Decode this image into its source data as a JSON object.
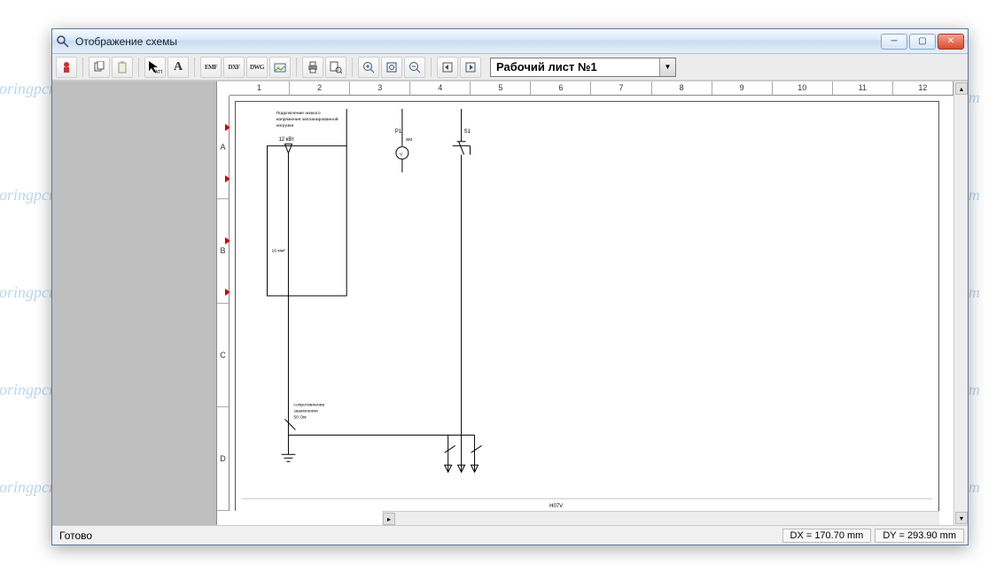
{
  "window": {
    "title": "Отображение схемы"
  },
  "toolbar": {
    "export_emf": "EMF",
    "export_dxf": "DXF",
    "export_dwg": "DWG",
    "att": "ATT",
    "sheet_selector": "Рабочий лист №1"
  },
  "ruler": {
    "cols": [
      "1",
      "2",
      "3",
      "4",
      "5",
      "6",
      "7",
      "8",
      "9",
      "10",
      "11",
      "12"
    ],
    "rows": [
      "A",
      "B",
      "C",
      "D"
    ]
  },
  "schema": {
    "header1": "Подключение низкого",
    "header2": "напряжения запланированной",
    "header3": "нагрузки",
    "load_val": "12 кВт",
    "p1": "P1",
    "sm": "SM",
    "s1": "S1",
    "v": "V",
    "cable": "16 мм²",
    "gnd1": "сопротивление",
    "gnd2": "заземления",
    "gnd_val": "50 Ом",
    "bottom_label": "H07V"
  },
  "status": {
    "ready": "Готово",
    "dx": "DX = 170.70 mm",
    "dy": "DY = 293.90 mm"
  },
  "watermark": "Soringpcrepair.Com"
}
